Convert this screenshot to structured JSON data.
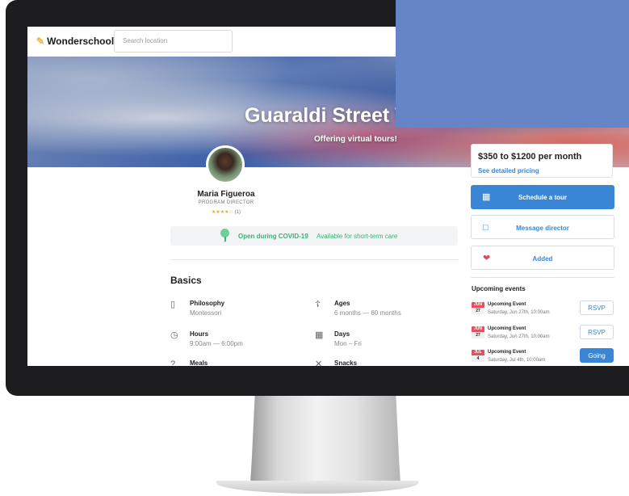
{
  "topbar": {
    "logo": "Wonderschool",
    "search_placeholder": "Search location"
  },
  "hero": {
    "title": "Guaraldi Street W",
    "subtitle": "Offering virtual tours!"
  },
  "director": {
    "name": "Maria Figueroa",
    "role": "PROGRAM DIRECTOR",
    "stars": "★★★★☆",
    "count": "(1)"
  },
  "covid": {
    "status": "Open during COVID-19",
    "extra": "Available for short-term care",
    "color": "#3fae76"
  },
  "basics": {
    "title": "Basics",
    "items": [
      {
        "label": "Philosophy",
        "value": "Montessori",
        "icon": "clipboard-icon"
      },
      {
        "label": "Ages",
        "value": "6 months — 60 months",
        "icon": "cake-icon"
      },
      {
        "label": "Hours",
        "value": "9:00am — 6:00pm",
        "icon": "clock-icon"
      },
      {
        "label": "Days",
        "value": "Mon – Fri",
        "icon": "calendar-icon"
      },
      {
        "label": "Meals",
        "value": "",
        "icon": "meals-icon"
      },
      {
        "label": "Snacks",
        "value": "",
        "icon": "snacks-icon"
      }
    ]
  },
  "sidebar": {
    "price": "$350 to $1200 per month",
    "pricing_link": "See detailed pricing",
    "schedule_label": "Schedule a tour",
    "message_label": "Message director",
    "added_label": "Added",
    "events_title": "Upcoming events",
    "events": [
      {
        "month": "JUN",
        "day": "27",
        "name": "Upcoming Event",
        "date": "Saturday, Jun 27th, 10:00am",
        "action": "RSVP"
      },
      {
        "month": "JUN",
        "day": "27",
        "name": "Upcoming Event",
        "date": "Saturday, Jun 27th, 10:00am",
        "action": "RSVP"
      },
      {
        "month": "JUL",
        "day": "4",
        "name": "Upcoming Event",
        "date": "Saturday, Jul 4th, 10:00am",
        "action": "Going"
      }
    ]
  },
  "colors": {
    "accent": "#3a86d6",
    "overlay": "#6585c6",
    "heart": "#e04b5a"
  }
}
